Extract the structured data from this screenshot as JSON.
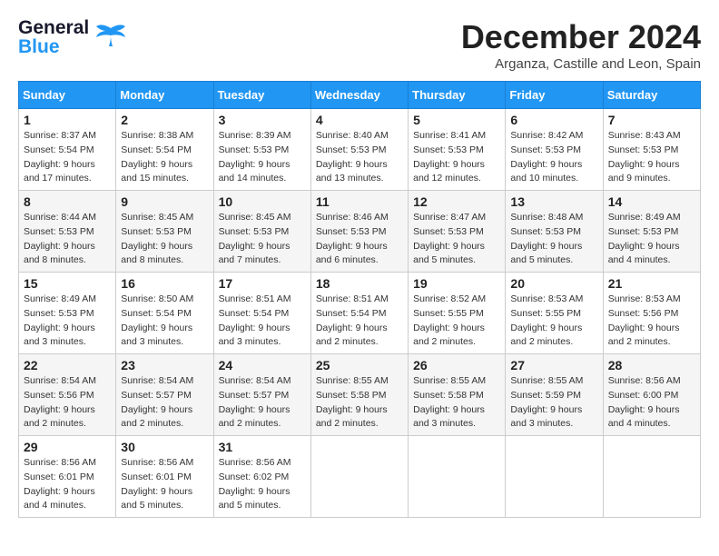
{
  "header": {
    "logo_general": "General",
    "logo_blue": "Blue",
    "month_title": "December 2024",
    "location": "Arganza, Castille and Leon, Spain"
  },
  "weekdays": [
    "Sunday",
    "Monday",
    "Tuesday",
    "Wednesday",
    "Thursday",
    "Friday",
    "Saturday"
  ],
  "weeks": [
    [
      {
        "day": "1",
        "sunrise": "8:37 AM",
        "sunset": "5:54 PM",
        "daylight": "9 hours and 17 minutes."
      },
      {
        "day": "2",
        "sunrise": "8:38 AM",
        "sunset": "5:54 PM",
        "daylight": "9 hours and 15 minutes."
      },
      {
        "day": "3",
        "sunrise": "8:39 AM",
        "sunset": "5:53 PM",
        "daylight": "9 hours and 14 minutes."
      },
      {
        "day": "4",
        "sunrise": "8:40 AM",
        "sunset": "5:53 PM",
        "daylight": "9 hours and 13 minutes."
      },
      {
        "day": "5",
        "sunrise": "8:41 AM",
        "sunset": "5:53 PM",
        "daylight": "9 hours and 12 minutes."
      },
      {
        "day": "6",
        "sunrise": "8:42 AM",
        "sunset": "5:53 PM",
        "daylight": "9 hours and 10 minutes."
      },
      {
        "day": "7",
        "sunrise": "8:43 AM",
        "sunset": "5:53 PM",
        "daylight": "9 hours and 9 minutes."
      }
    ],
    [
      {
        "day": "8",
        "sunrise": "8:44 AM",
        "sunset": "5:53 PM",
        "daylight": "9 hours and 8 minutes."
      },
      {
        "day": "9",
        "sunrise": "8:45 AM",
        "sunset": "5:53 PM",
        "daylight": "9 hours and 8 minutes."
      },
      {
        "day": "10",
        "sunrise": "8:45 AM",
        "sunset": "5:53 PM",
        "daylight": "9 hours and 7 minutes."
      },
      {
        "day": "11",
        "sunrise": "8:46 AM",
        "sunset": "5:53 PM",
        "daylight": "9 hours and 6 minutes."
      },
      {
        "day": "12",
        "sunrise": "8:47 AM",
        "sunset": "5:53 PM",
        "daylight": "9 hours and 5 minutes."
      },
      {
        "day": "13",
        "sunrise": "8:48 AM",
        "sunset": "5:53 PM",
        "daylight": "9 hours and 5 minutes."
      },
      {
        "day": "14",
        "sunrise": "8:49 AM",
        "sunset": "5:53 PM",
        "daylight": "9 hours and 4 minutes."
      }
    ],
    [
      {
        "day": "15",
        "sunrise": "8:49 AM",
        "sunset": "5:53 PM",
        "daylight": "9 hours and 3 minutes."
      },
      {
        "day": "16",
        "sunrise": "8:50 AM",
        "sunset": "5:54 PM",
        "daylight": "9 hours and 3 minutes."
      },
      {
        "day": "17",
        "sunrise": "8:51 AM",
        "sunset": "5:54 PM",
        "daylight": "9 hours and 3 minutes."
      },
      {
        "day": "18",
        "sunrise": "8:51 AM",
        "sunset": "5:54 PM",
        "daylight": "9 hours and 2 minutes."
      },
      {
        "day": "19",
        "sunrise": "8:52 AM",
        "sunset": "5:55 PM",
        "daylight": "9 hours and 2 minutes."
      },
      {
        "day": "20",
        "sunrise": "8:53 AM",
        "sunset": "5:55 PM",
        "daylight": "9 hours and 2 minutes."
      },
      {
        "day": "21",
        "sunrise": "8:53 AM",
        "sunset": "5:56 PM",
        "daylight": "9 hours and 2 minutes."
      }
    ],
    [
      {
        "day": "22",
        "sunrise": "8:54 AM",
        "sunset": "5:56 PM",
        "daylight": "9 hours and 2 minutes."
      },
      {
        "day": "23",
        "sunrise": "8:54 AM",
        "sunset": "5:57 PM",
        "daylight": "9 hours and 2 minutes."
      },
      {
        "day": "24",
        "sunrise": "8:54 AM",
        "sunset": "5:57 PM",
        "daylight": "9 hours and 2 minutes."
      },
      {
        "day": "25",
        "sunrise": "8:55 AM",
        "sunset": "5:58 PM",
        "daylight": "9 hours and 2 minutes."
      },
      {
        "day": "26",
        "sunrise": "8:55 AM",
        "sunset": "5:58 PM",
        "daylight": "9 hours and 3 minutes."
      },
      {
        "day": "27",
        "sunrise": "8:55 AM",
        "sunset": "5:59 PM",
        "daylight": "9 hours and 3 minutes."
      },
      {
        "day": "28",
        "sunrise": "8:56 AM",
        "sunset": "6:00 PM",
        "daylight": "9 hours and 4 minutes."
      }
    ],
    [
      {
        "day": "29",
        "sunrise": "8:56 AM",
        "sunset": "6:01 PM",
        "daylight": "9 hours and 4 minutes."
      },
      {
        "day": "30",
        "sunrise": "8:56 AM",
        "sunset": "6:01 PM",
        "daylight": "9 hours and 5 minutes."
      },
      {
        "day": "31",
        "sunrise": "8:56 AM",
        "sunset": "6:02 PM",
        "daylight": "9 hours and 5 minutes."
      },
      null,
      null,
      null,
      null
    ]
  ]
}
